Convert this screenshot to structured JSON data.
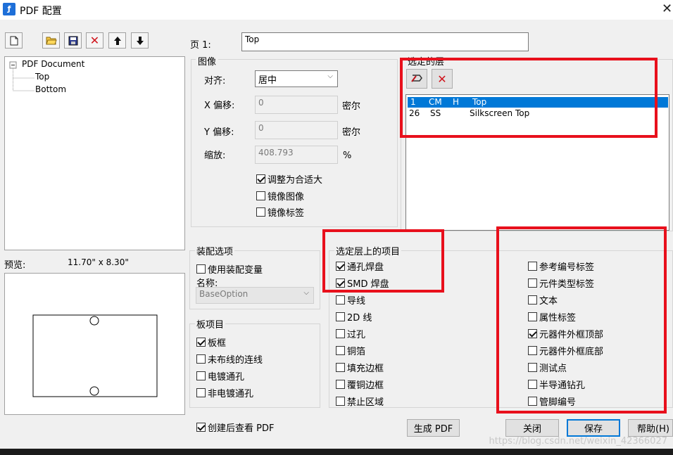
{
  "window": {
    "title": "PDF 配置",
    "app_icon": "pdf-config-app-icon"
  },
  "toolbar": {
    "buttons": [
      {
        "name": "new-icon",
        "glyph": "🗋"
      },
      {
        "name": "open-folder-icon",
        "glyph": "📂"
      },
      {
        "name": "save-disk-icon",
        "glyph": "💾"
      },
      {
        "name": "delete-x-icon",
        "glyph": "✕"
      },
      {
        "name": "move-up-arrow-icon",
        "glyph": "🡅"
      },
      {
        "name": "move-down-arrow-icon",
        "glyph": "🡇"
      }
    ]
  },
  "tree": {
    "root": "PDF Document",
    "children": [
      "Top",
      "Bottom"
    ]
  },
  "page": {
    "label": "页 1:",
    "value": "Top"
  },
  "image": {
    "heading": "图像",
    "align_label": "对齐:",
    "align_value": "居中",
    "x_offset_label": "X 偏移:",
    "x_offset_value": "0",
    "x_unit": "密尔",
    "y_offset_label": "Y 偏移:",
    "y_offset_value": "0",
    "y_unit": "密尔",
    "scale_label": "缩放:",
    "scale_value": "408.793",
    "scale_unit": "%",
    "fit_label": "调整为合适大",
    "fit_checked": true,
    "mirror_image_label": "镜像图像",
    "mirror_image_checked": false,
    "mirror_label_label": "镜像标签",
    "mirror_label_checked": false
  },
  "selected_layers": {
    "heading": "选定的层",
    "add_icon": "layer-link-icon",
    "remove_icon": "remove-x-icon",
    "rows": [
      {
        "num": "1",
        "code": "CM",
        "flag": "H",
        "name": "Top",
        "selected": true
      },
      {
        "num": "26",
        "code": "SS",
        "flag": "",
        "name": "Silkscreen Top",
        "selected": false
      }
    ]
  },
  "preview": {
    "label": "预览:",
    "size": "11.70\" x  8.30\""
  },
  "assembly": {
    "heading": "装配选项",
    "use_variant_label": "使用装配变量",
    "use_variant_checked": false,
    "name_label": "名称:",
    "name_value": "BaseOption"
  },
  "board": {
    "heading": "板项目",
    "items": [
      {
        "label": "板框",
        "checked": true
      },
      {
        "label": "未布线的连线",
        "checked": false
      },
      {
        "label": "电镀通孔",
        "checked": false
      },
      {
        "label": "非电镀通孔",
        "checked": false
      }
    ]
  },
  "layer_items": {
    "heading": "选定层上的项目",
    "left": [
      {
        "label": "通孔焊盘",
        "checked": true
      },
      {
        "label": "SMD 焊盘",
        "checked": true
      },
      {
        "label": "导线",
        "checked": false
      },
      {
        "label": "2D 线",
        "checked": false
      },
      {
        "label": "过孔",
        "checked": false
      },
      {
        "label": "铜箔",
        "checked": false
      },
      {
        "label": "填充边框",
        "checked": false
      },
      {
        "label": "覆铜边框",
        "checked": false
      },
      {
        "label": "禁止区域",
        "checked": false
      }
    ],
    "right": [
      {
        "label": "参考编号标签",
        "checked": false
      },
      {
        "label": "元件类型标签",
        "checked": false
      },
      {
        "label": "文本",
        "checked": false
      },
      {
        "label": "属性标签",
        "checked": false
      },
      {
        "label": "元器件外框顶部",
        "checked": true
      },
      {
        "label": "元器件外框底部",
        "checked": false
      },
      {
        "label": "测试点",
        "checked": false
      },
      {
        "label": "半导通钻孔",
        "checked": false
      },
      {
        "label": "管脚编号",
        "checked": false
      }
    ]
  },
  "footer": {
    "view_after_label": "创建后查看 PDF",
    "view_after_checked": true,
    "generate_label": "生成 PDF",
    "close_label": "关闭",
    "save_label": "保存",
    "help_label": "帮助(H)"
  },
  "watermark": "https://blog.csdn.net/weixin_42366027",
  "colors": {
    "highlight": "#e8101c",
    "selection": "#0078d7"
  }
}
